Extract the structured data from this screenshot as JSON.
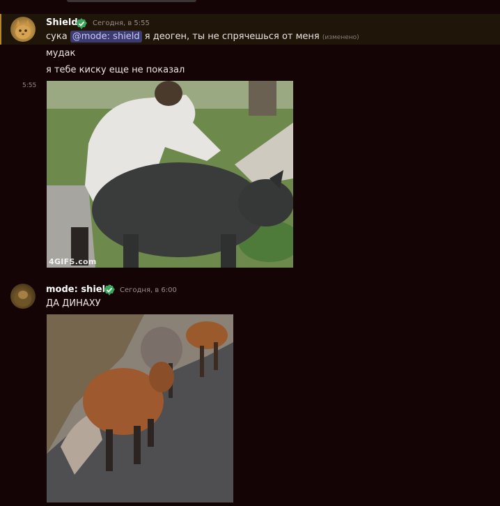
{
  "colors": {
    "background": "#140406",
    "highlight": "#1f1509",
    "mention_bg": "#3c3a6e",
    "badge": "#3ba55c"
  },
  "messages": [
    {
      "author": "Shield",
      "timestamp": "Сегодня, в 5:55",
      "line1_prefix": "сука ",
      "mention": "@mode: shield",
      "line1_suffix": " я деоген, ты не спрячешься от меня",
      "edited": "(изменено)",
      "line2": "мудак",
      "line3": "я тебе киску еще не показал",
      "gif_time": "5:55",
      "gif_watermark": "4GIFS.com",
      "badge_icon": "verified-badge-icon"
    },
    {
      "author": "mode: shield",
      "timestamp": "Сегодня, в 6:00",
      "text": "ДА ДИНАХУ",
      "badge_icon": "verified-badge-icon"
    }
  ]
}
